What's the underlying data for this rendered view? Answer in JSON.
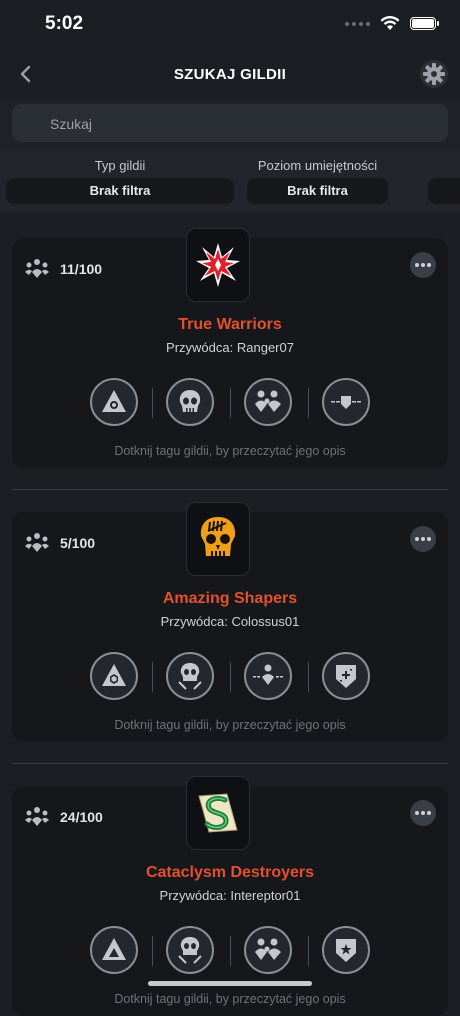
{
  "status": {
    "time": "5:02"
  },
  "nav": {
    "title": "SZUKAJ GILDII"
  },
  "search": {
    "placeholder": "Szukaj"
  },
  "filters": [
    {
      "label": "Typ gildii",
      "value": "Brak filtra"
    },
    {
      "label": "Poziom umiejętności",
      "value": "Brak filtra"
    }
  ],
  "guilds": [
    {
      "members": "11/100",
      "name": "True Warriors",
      "leader_prefix": "Przywódca:",
      "leader": "Ranger07",
      "hint": "Dotknij tagu gildii, by przeczytać jego opis",
      "emblem": "red-star-emblem",
      "tags": [
        "triangle-eye-icon",
        "skull-icon",
        "group-icon",
        "shield-dashes-icon"
      ]
    },
    {
      "members": "5/100",
      "name": "Amazing Shapers",
      "leader_prefix": "Przywódca:",
      "leader": "Colossus01",
      "hint": "Dotknij tagu gildii, by przeczytać jego opis",
      "emblem": "orange-skull-emblem",
      "tags": [
        "triangle-hexagon-icon",
        "skull-crossed-icon",
        "person-dashes-icon",
        "shield-plus-icon"
      ]
    },
    {
      "members": "24/100",
      "name": "Cataclysm Destroyers",
      "leader_prefix": "Przywódca:",
      "leader": "Intereptor01",
      "hint": "Dotknij tagu gildii, by przeczytać jego opis",
      "emblem": "green-s-scroll-emblem",
      "tags": [
        "triangle-icon",
        "skull-crossed-icon",
        "group-icon",
        "shield-star-icon"
      ]
    }
  ],
  "colors": {
    "accent": "#e3502d",
    "background": "#1b1e23",
    "card": "#15171b"
  }
}
